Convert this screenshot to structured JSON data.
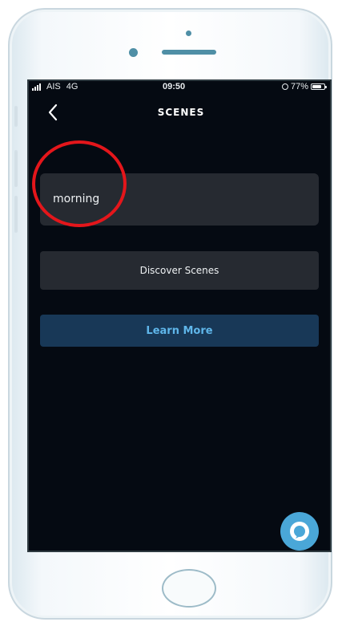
{
  "status_bar": {
    "carrier": "AIS",
    "network": "4G",
    "time": "09:50",
    "battery": "77%",
    "battery_level": 0.77,
    "icons": [
      "signal-icon",
      "rotation-lock-icon",
      "battery-icon"
    ]
  },
  "nav": {
    "back_icon": "chevron-left-icon",
    "title": "SCENES"
  },
  "scene": {
    "name": "morning"
  },
  "buttons": {
    "discover_label": "Discover Scenes",
    "learn_label": "Learn More"
  },
  "alexa": {
    "icon": "alexa-icon"
  },
  "colors": {
    "screen_background": "#050a12",
    "card_background": "#262a31",
    "learn_background": "#183857",
    "learn_text": "#5fb6ea",
    "alexa_accent": "#4aa7d8",
    "highlight": "#e4161b"
  }
}
